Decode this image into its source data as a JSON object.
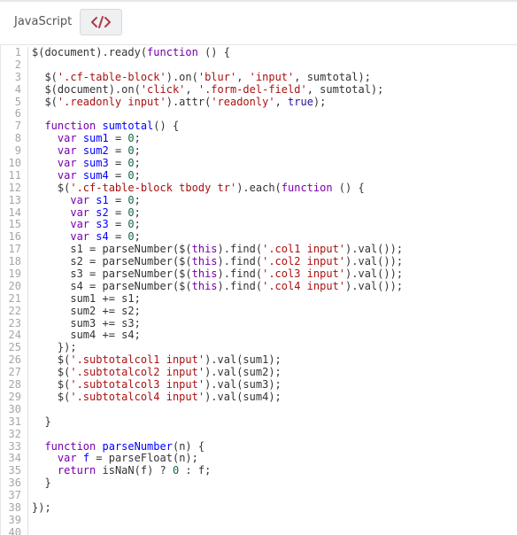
{
  "header": {
    "language_label": "JavaScript",
    "code_toggle_icon": "code-brackets-icon"
  },
  "colors": {
    "keyword": "#7700aa",
    "definition": "#0000ff",
    "string": "#aa1111",
    "number": "#116644",
    "atom": "#221199",
    "variable": "#0055aa",
    "plain": "#333333",
    "gutter": "#a6a6a6"
  },
  "editor": {
    "lines": [
      "$(document).ready(function () {",
      "",
      "  $('.cf-table-block').on('blur', 'input', sumtotal);",
      "  $(document).on('click', '.form-del-field', sumtotal);",
      "  $('.readonly input').attr('readonly', true);",
      "",
      "  function sumtotal() {",
      "    var sum1 = 0;",
      "    var sum2 = 0;",
      "    var sum3 = 0;",
      "    var sum4 = 0;",
      "    $('.cf-table-block tbody tr').each(function () {",
      "      var s1 = 0;",
      "      var s2 = 0;",
      "      var s3 = 0;",
      "      var s4 = 0;",
      "      s1 = parseNumber($(this).find('.col1 input').val());",
      "      s2 = parseNumber($(this).find('.col2 input').val());",
      "      s3 = parseNumber($(this).find('.col3 input').val());",
      "      s4 = parseNumber($(this).find('.col4 input').val());",
      "      sum1 += s1;",
      "      sum2 += s2;",
      "      sum3 += s3;",
      "      sum4 += s4;",
      "    });",
      "    $('.subtotalcol1 input').val(sum1);",
      "    $('.subtotalcol2 input').val(sum2);",
      "    $('.subtotalcol3 input').val(sum3);",
      "    $('.subtotalcol4 input').val(sum4);",
      "",
      "  }",
      "",
      "  function parseNumber(n) {",
      "    var f = parseFloat(n);",
      "    return isNaN(f) ? 0 : f;",
      "  }",
      "",
      "});",
      "",
      ""
    ]
  }
}
